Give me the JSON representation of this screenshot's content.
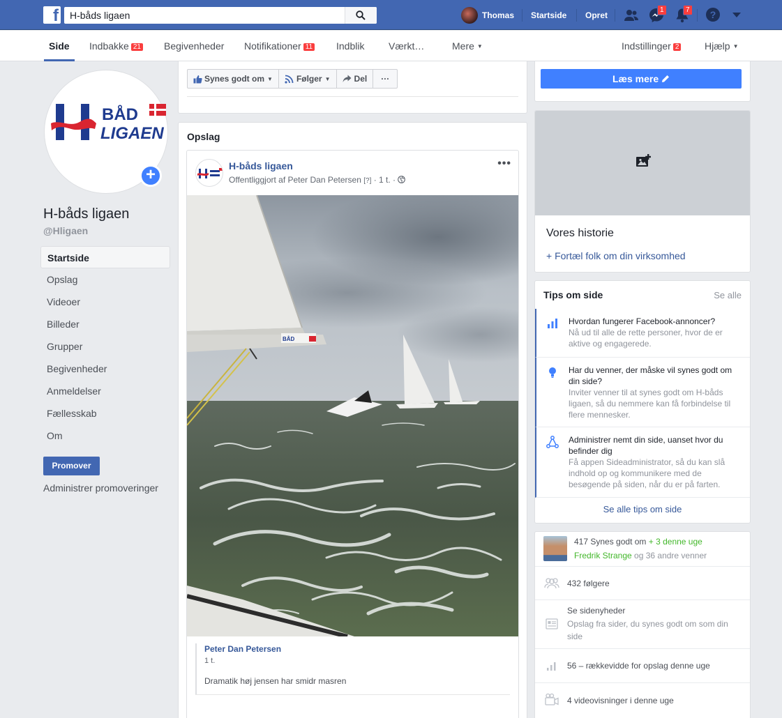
{
  "topbar": {
    "search_value": "H-båds ligaen",
    "user_name": "Thomas",
    "home_label": "Startside",
    "create_label": "Opret",
    "messages_badge": "1",
    "notifications_badge": "7"
  },
  "subnav": {
    "tabs": [
      {
        "label": "Side"
      },
      {
        "label": "Indbakke",
        "count": "21"
      },
      {
        "label": "Begivenheder"
      },
      {
        "label": "Notifikationer",
        "count": "11"
      },
      {
        "label": "Indblik"
      },
      {
        "label": "Værkt…"
      },
      {
        "label": "Mere"
      }
    ],
    "settings_label": "Indstillinger",
    "settings_count": "2",
    "help_label": "Hjælp"
  },
  "page": {
    "name": "H-båds ligaen",
    "handle": "@Hligaen",
    "logo_line1": "BÅD",
    "logo_line2": "LIGAEN"
  },
  "leftnav": {
    "items": [
      "Startside",
      "Opslag",
      "Videoer",
      "Billeder",
      "Grupper",
      "Begivenheder",
      "Anmeldelser",
      "Fællesskab",
      "Om"
    ],
    "promote_label": "Promover",
    "manage_promotions": "Administrer promoveringer"
  },
  "actions": {
    "like": "Synes godt om",
    "follow": "Følger",
    "share": "Del",
    "more": "···"
  },
  "posts": {
    "title": "Opslag",
    "author": "H-båds ligaen",
    "meta_prefix": "Offentliggjort af Peter Dan Petersen",
    "meta_q": "[?]",
    "meta_time": "· 1 t. ·",
    "more": "•••",
    "comment_author": "Peter Dan Petersen",
    "comment_time": "1 t.",
    "comment_text": "Dramatik høj jensen har smidr masren"
  },
  "right": {
    "read_more": "Læs mere",
    "story_title": "Vores historie",
    "story_link": "+ Fortæl folk om din virksomhed",
    "tips_title": "Tips om side",
    "tips_see_all": "Se alle",
    "tips": [
      {
        "title": "Hvordan fungerer Facebook-annoncer?",
        "desc": "Nå ud til alle de rette personer, hvor de er aktive og engagerede."
      },
      {
        "title": "Har du venner, der måske vil synes godt om din side?",
        "desc": "Inviter venner til at synes godt om H-båds ligaen, så du nemmere kan få forbindelse til flere mennesker."
      },
      {
        "title": "Administrer nemt din side, uanset hvor du befinder dig",
        "desc": "Få appen Sideadministrator, så du kan slå indhold op og kommunikere med de besøgende på siden, når du er på farten."
      }
    ],
    "tips_footer": "Se alle tips om side",
    "likes_text": "417 Synes godt om",
    "likes_week": "+ 3 denne uge",
    "friend_name": "Fredrik Strange",
    "friend_rest": "og 36 andre venner",
    "followers": "432 følgere",
    "page_updates_title": "Se sidenyheder",
    "page_updates_desc": "Opslag fra sider, du synes godt om som din side",
    "reach": "56 – rækkevidde for opslag denne uge",
    "video_views": "4 videovisninger i denne uge"
  },
  "colors": {
    "brand_blue": "#4267b2",
    "action_blue": "#4080ff",
    "badge_red": "#fa3e3e",
    "link_blue": "#365899",
    "positive_green": "#42b72a"
  }
}
